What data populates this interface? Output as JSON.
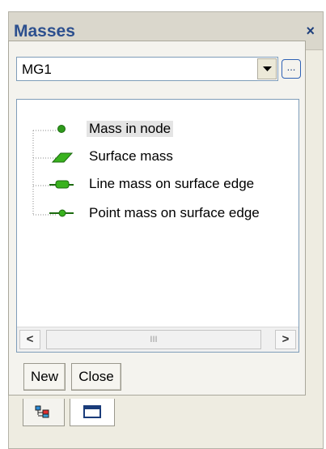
{
  "panel": {
    "title": "Masses",
    "close_glyph": "×"
  },
  "group_select": {
    "value": "MG1",
    "ellipsis_label": "..."
  },
  "tree": {
    "items": [
      {
        "label": "Mass in node",
        "icon": "node-mass-icon",
        "selected": true
      },
      {
        "label": "Surface mass",
        "icon": "surface-mass-icon",
        "selected": false
      },
      {
        "label": "Line mass on surface edge",
        "icon": "line-mass-icon",
        "selected": false
      },
      {
        "label": "Point mass on surface edge",
        "icon": "point-mass-icon",
        "selected": false
      }
    ]
  },
  "scrollbar": {
    "left_arrow": "<",
    "right_arrow": ">",
    "grip": "III"
  },
  "buttons": {
    "new_label": "New",
    "close_label": "Close"
  },
  "tabs": [
    {
      "icon": "tree-view-icon",
      "active": false
    },
    {
      "icon": "window-view-icon",
      "active": true
    }
  ],
  "colors": {
    "title": "#2c4f8e",
    "icon_green": "#2f9a1c"
  }
}
